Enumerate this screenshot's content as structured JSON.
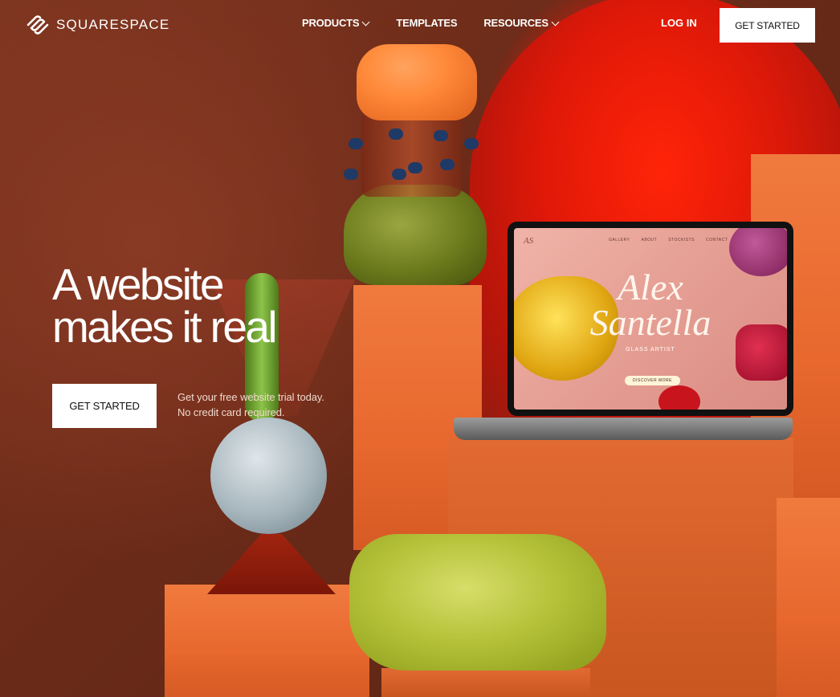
{
  "brand": {
    "name": "SQUARESPACE",
    "logo_icon": "squarespace-logo-icon"
  },
  "nav": {
    "links": [
      {
        "label": "PRODUCTS",
        "has_dropdown": true
      },
      {
        "label": "TEMPLATES",
        "has_dropdown": false
      },
      {
        "label": "RESOURCES",
        "has_dropdown": true
      }
    ],
    "login_label": "LOG IN",
    "cta_label": "GET STARTED"
  },
  "hero": {
    "headline_line1": "A website",
    "headline_line2": "makes it real",
    "cta_label": "GET STARTED",
    "note_line1": "Get your free website trial today.",
    "note_line2": "No credit card required."
  },
  "laptop_site": {
    "logo": "AS",
    "nav": [
      "GALLERY",
      "ABOUT",
      "STOCKISTS",
      "CONTACT"
    ],
    "title_line1": "Alex",
    "title_line2": "Santella",
    "subtitle": "GLASS ARTIST",
    "button": "DISCOVER MORE"
  },
  "colors": {
    "background": "#6e3220",
    "accent_red": "#e61a0a",
    "button_bg": "#ffffff",
    "button_text": "#111111"
  }
}
